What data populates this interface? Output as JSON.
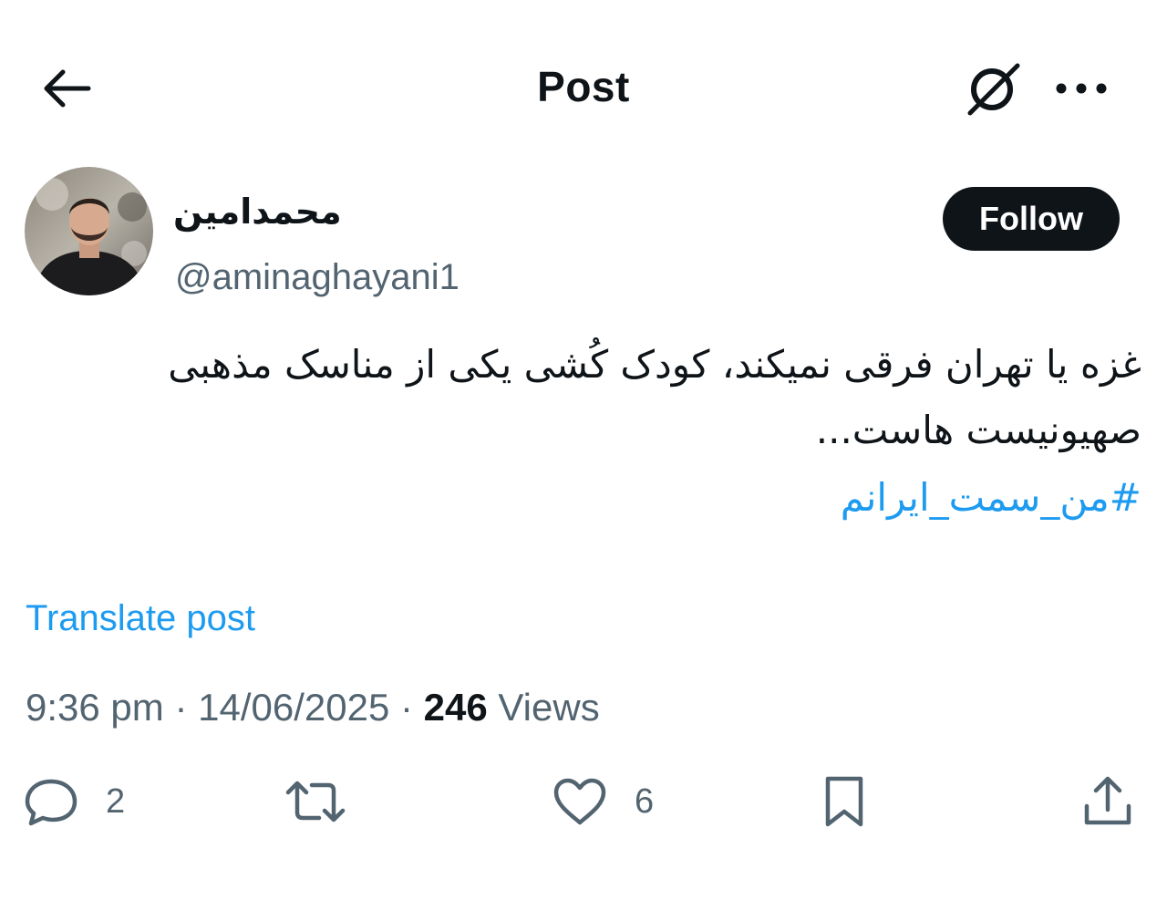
{
  "header": {
    "title": "Post",
    "back_icon": "arrow-left-icon",
    "grok_icon": "grok-icon",
    "more_icon": "more-horizontal-icon"
  },
  "author": {
    "display_name": "محمدامین",
    "handle": "@aminaghayani1",
    "follow_label": "Follow"
  },
  "post": {
    "text_line1": "غزه یا تهران فرقی نمیکند، کودک کُشی یکی از مناسک مذهبی",
    "text_line2": "صهیونیست هاست...",
    "hashtag": "#من_سمت_ایرانم",
    "translate_label": "Translate post"
  },
  "meta": {
    "time": "9:36 pm",
    "separator": "·",
    "date": "14/06/2025",
    "views_count": "246",
    "views_label": "Views"
  },
  "actions": {
    "reply_count": "2",
    "repost_count": "",
    "like_count": "6"
  },
  "colors": {
    "text": "#0f1419",
    "secondary": "#536471",
    "accent": "#1d9bf0",
    "follow_bg": "#0f1419"
  }
}
